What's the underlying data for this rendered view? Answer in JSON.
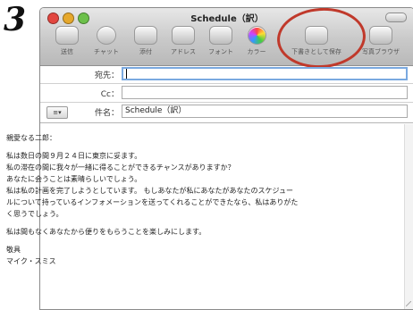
{
  "step_number": "3",
  "window": {
    "title": "Schedule（訳）",
    "traffic_light_colors": [
      "#e2463f",
      "#e6a82c",
      "#6cc04a"
    ],
    "annotation_ring_color": "#c0392b"
  },
  "toolbar": {
    "items": [
      {
        "label": "送信",
        "icon": "send-icon"
      },
      {
        "label": "チャット",
        "icon": "chat-icon"
      },
      {
        "label": "添付",
        "icon": "paperclip-icon"
      },
      {
        "label": "アドレス",
        "icon": "address-book-icon"
      },
      {
        "label": "フォント",
        "icon": "font-icon"
      },
      {
        "label": "カラー",
        "icon": "color-wheel-icon"
      },
      {
        "label": "下書きとして保存",
        "icon": "save-draft-icon"
      },
      {
        "label": "写真ブラウザ",
        "icon": "photo-browser-icon"
      }
    ]
  },
  "header": {
    "to_label": "宛先：",
    "to_value": "",
    "cc_label": "Cc：",
    "cc_value": "",
    "subject_label": "件名：",
    "subject_value": "Schedule（訳）",
    "account_button": "≡▾"
  },
  "message": {
    "greeting": "親愛なる二郎：",
    "lines": [
      "私は数日の間９月２４日に東京に妥ます。",
      "私の滞在の間に我々が一緒に得ることができるチャンスがありますか？",
      "あなたに会うことは素晴らしいでしょう。",
      "私は私の計画を完了しようとしています。 もしあなたが私にあなたがあなたのスケジュー",
      "ルについて持っているインフォメーションを送ってくれることができたなら、私はありがた",
      "く思うでしょう。"
    ],
    "closing_line": "私は間もなくあなたから便りをもらうことを楽しみにします。",
    "signoff": "敬具",
    "signature": "マイク・スミス"
  }
}
